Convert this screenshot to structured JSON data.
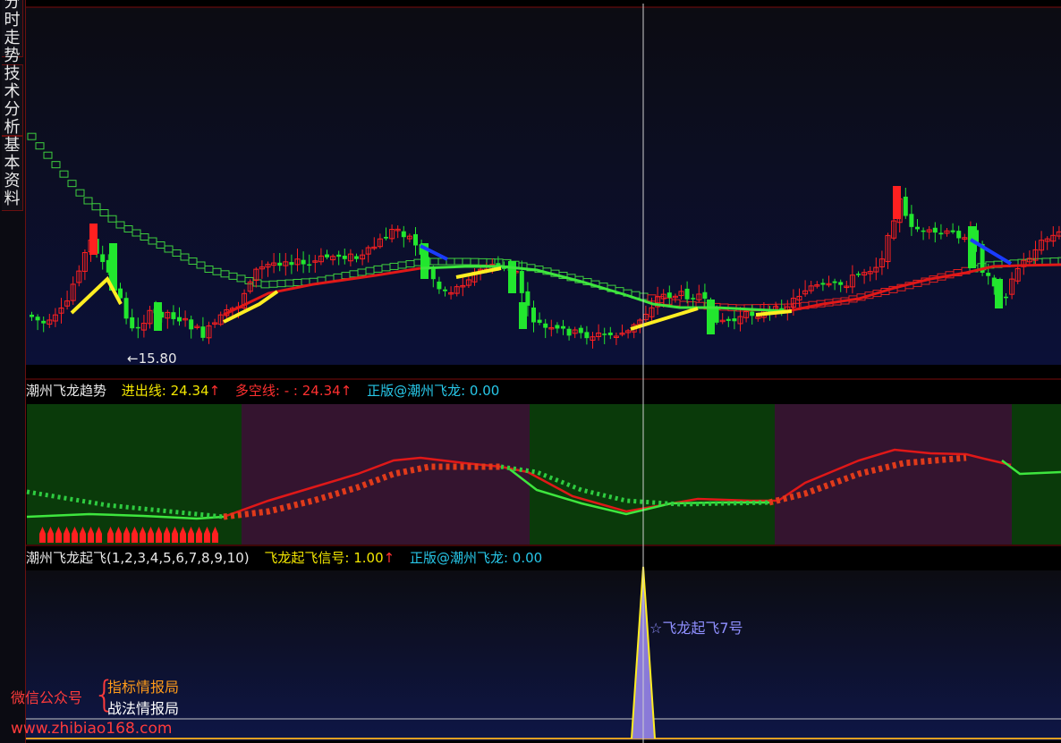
{
  "side_tabs": [
    {
      "label": "分时走势",
      "active": false
    },
    {
      "label": "技术分析",
      "active": true
    },
    {
      "label": "基本资料",
      "active": false
    }
  ],
  "main_chart": {
    "low_marker": "←15.80"
  },
  "panel2": {
    "title": "潮州飞龙趋势",
    "items": [
      {
        "text": "进出线: 24.34",
        "arrow": "↑",
        "color": "#f2e600"
      },
      {
        "text": "多空线: - : 24.34",
        "arrow": "↑",
        "color": "#ff3030"
      },
      {
        "text": "正版@潮州飞龙: 0.00",
        "arrow": "",
        "color": "#27c7e8"
      }
    ]
  },
  "panel3": {
    "title": "潮州飞龙起飞(1,2,3,4,5,6,7,8,9,10)",
    "items": [
      {
        "text": "飞龙起飞信号: 1.00",
        "arrow": "↑",
        "color": "#f2e600"
      },
      {
        "text": "正版@潮州飞龙: 0.00",
        "arrow": "",
        "color": "#27c7e8"
      }
    ],
    "signal_label": "☆飞龙起飞7号"
  },
  "watermark": {
    "left": "微信公众号",
    "brace": "{",
    "line1": "指标情报局",
    "line2": "战法情报局",
    "url": "www.zhibiao168.com"
  },
  "colors": {
    "up": "#ff2020",
    "down": "#22e62e",
    "ma_up": "#e01818",
    "ma_down": "#3ee63e",
    "yellow": "#ffee22",
    "blue": "#1a3cff",
    "bull_zone": "#0a3a0a",
    "bear_zone": "#34142f"
  }
}
